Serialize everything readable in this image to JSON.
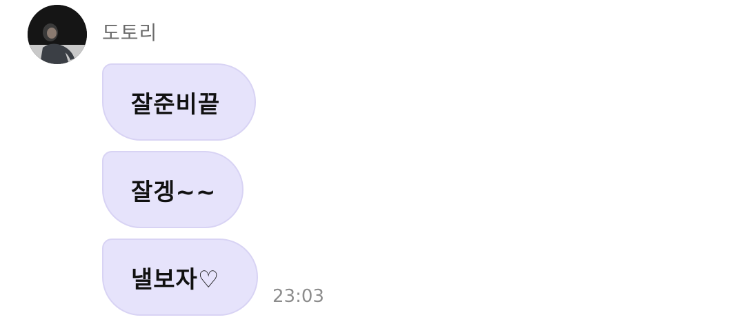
{
  "sender": {
    "name": "도토리",
    "avatar_icon": "profile-photo-avatar"
  },
  "messages": [
    {
      "text": "잘준비끝"
    },
    {
      "text": "잘겡~~"
    },
    {
      "text": "낼보자♡"
    }
  ],
  "timestamp": "23:03",
  "colors": {
    "bubble": "#e6e3fb",
    "bubble_border": "#d8d3f4",
    "name": "#6b6b6b",
    "time": "#8c8c8c"
  }
}
